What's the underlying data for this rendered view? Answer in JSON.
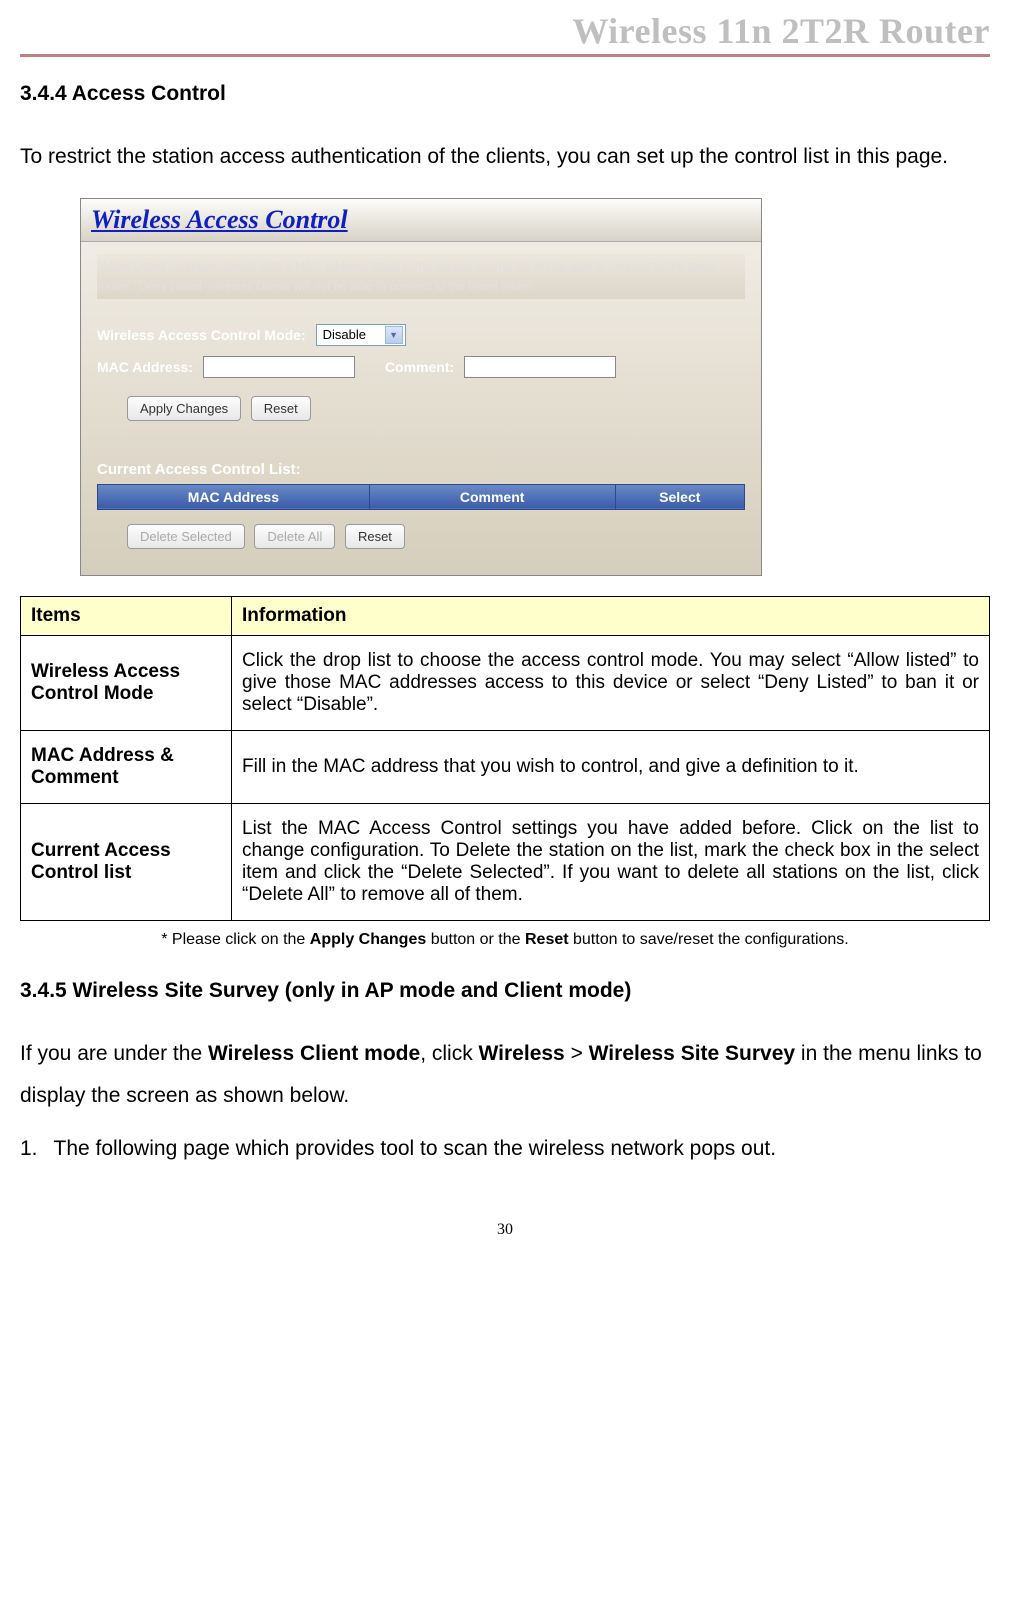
{
  "header": {
    "title": "Wireless 11n 2T2R Router"
  },
  "section_344": {
    "heading": "3.4.4 Access Control",
    "intro": "To restrict the station access authentication of the clients, you can set up the control list in this page."
  },
  "screenshot": {
    "title": "Wireless Access Control",
    "description": "\"Allow Listed\", wireless clients with a MAC address listed in the access control list will be able to connect to the travel router. \"Deny Listed\" wireless clients will not be able to connect to the travel router.",
    "mode_label": "Wireless Access Control Mode:",
    "mode_value": "Disable",
    "mac_label": "MAC Address:",
    "comment_label": "Comment:",
    "apply_btn": "Apply Changes",
    "reset_btn": "Reset",
    "current_list_label": "Current Access Control List:",
    "col_mac": "MAC Address",
    "col_comment": "Comment",
    "col_select": "Select",
    "delete_selected_btn": "Delete Selected",
    "delete_all_btn": "Delete All",
    "reset2_btn": "Reset"
  },
  "info_table": {
    "header_items": "Items",
    "header_info": "Information",
    "rows": [
      {
        "item": "Wireless Access Control Mode",
        "info": "Click the drop list to choose the access control mode. You may select “Allow listed” to give those MAC addresses access to this device or select “Deny Listed” to ban it or select “Disable”."
      },
      {
        "item": "MAC Address & Comment",
        "info": "Fill in the MAC address that you wish to control, and give a definition to it."
      },
      {
        "item": "Current Access Control list",
        "info": "List the MAC Access Control settings you have added before. Click on the list to change configuration. To Delete the station on the list, mark the check box in the select item and click the “Delete Selected”. If you want to delete all stations on the list, click “Delete All” to remove all of them."
      }
    ]
  },
  "footnote": {
    "prefix": "* Please click on the ",
    "apply": "Apply Changes",
    "mid": " button or the ",
    "reset": "Reset",
    "suffix": " button to save/reset the configurations."
  },
  "section_345": {
    "heading": "3.4.5 Wireless Site Survey (only in AP mode and Client mode)",
    "intro_prefix": "If you are under the ",
    "bold1": "Wireless Client mode",
    "intro_mid1": ", click ",
    "bold2": "Wireless",
    "intro_mid2": " > ",
    "bold3": "Wireless Site Survey",
    "intro_suffix": " in the menu links to display the screen as shown below.",
    "list_num": "1.",
    "list_text": "The following page which provides tool to scan the wireless network pops out."
  },
  "page_number": "30"
}
